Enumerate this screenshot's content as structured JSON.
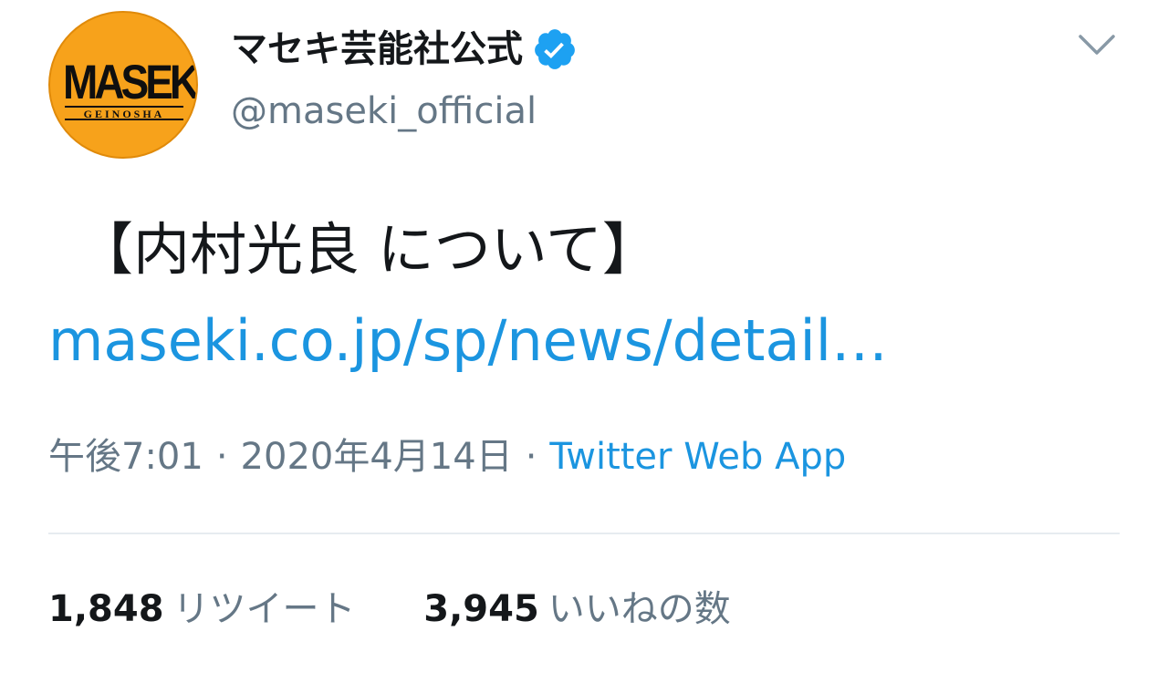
{
  "header": {
    "avatar": {
      "brand": "MASEKI",
      "sub": "GEINOSHA",
      "background": "#f7a21b"
    },
    "display_name": "マセキ芸能社公式",
    "handle": "@maseki_official",
    "verified_icon": "verified-badge-icon",
    "menu_icon": "chevron-down-icon"
  },
  "tweet": {
    "text": "【内村光良 について】",
    "link": "maseki.co.jp/sp/news/detail…",
    "time": "午後7:01",
    "date": "2020年4月14日",
    "separator": "·",
    "source": "Twitter Web App"
  },
  "stats": {
    "retweets": {
      "count": "1,848",
      "label": "リツイート"
    },
    "likes": {
      "count": "3,945",
      "label": "いいねの数"
    }
  },
  "colors": {
    "accent": "#1b95e0",
    "secondary_text": "#657786",
    "primary_text": "#14171a",
    "divider": "#e6ecf0",
    "verified": "#1da1f2"
  }
}
